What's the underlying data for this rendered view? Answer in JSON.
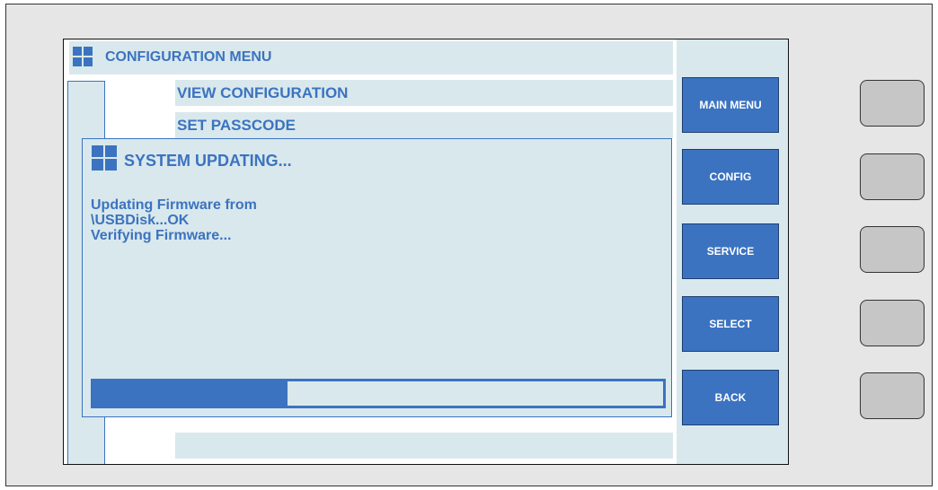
{
  "window": {
    "title": "CONFIGURATION MENU"
  },
  "menu": {
    "items": [
      {
        "label": "VIEW CONFIGURATION"
      },
      {
        "label": "SET PASSCODE"
      },
      {
        "label": ""
      }
    ]
  },
  "dialog": {
    "title": "SYSTEM UPDATING...",
    "lines": [
      "Updating Firmware from",
      "\\USBDisk...OK",
      "Verifying Firmware..."
    ],
    "progress": 0.34
  },
  "soft_buttons": [
    {
      "label": "MAIN MENU"
    },
    {
      "label": "CONFIG"
    },
    {
      "label": "SERVICE"
    },
    {
      "label": "SELECT"
    },
    {
      "label": "BACK"
    }
  ],
  "colors": {
    "accent": "#3b73c0",
    "panel": "#d9e8ec",
    "hardware_button": "#c6c6c6"
  },
  "icons": {
    "window_icon": "windows-logo-icon"
  }
}
